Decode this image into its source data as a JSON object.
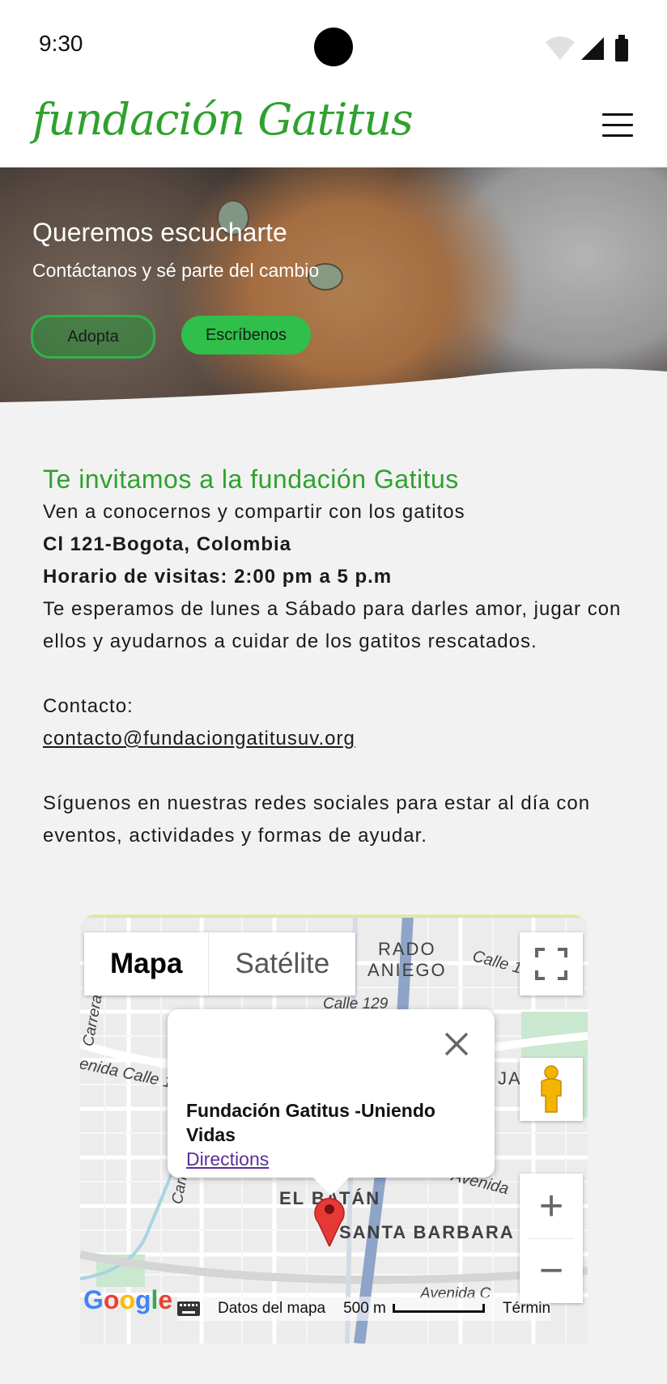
{
  "status_bar": {
    "time": "9:30"
  },
  "header": {
    "logo": "fundación Gatitus",
    "menu_icon": "hamburger-menu-icon"
  },
  "hero": {
    "title": "Queremos escucharte",
    "subtitle": "Contáctanos y sé parte del cambio",
    "buttons": {
      "adopt": "Adopta",
      "write": "Escríbenos"
    }
  },
  "content": {
    "heading": "Te invitamos a la fundación Gatitus",
    "line1": "Ven a conocernos y compartir con los gatitos",
    "address": "Cl 121-Bogota, Colombia",
    "hours": "Horario de visitas: 2:00 pm a 5 p.m",
    "description": "Te esperamos de lunes a Sábado para darles amor, jugar con ellos y ayudarnos a cuidar de los gatitos rescatados.",
    "contact_label": "Contacto:",
    "contact_email": "contacto@fundaciongatitusuv.org",
    "social_text": "Síguenos en nuestras redes sociales para estar al día con eventos, actividades y formas de ayudar."
  },
  "map": {
    "type_options": {
      "map": "Mapa",
      "satellite": "Satélite"
    },
    "info_window": {
      "place_name": "Fundación Gatitus -Uniendo Vidas",
      "directions": "Directions"
    },
    "zoom": {
      "in": "+",
      "out": "−"
    },
    "labels": {
      "rado": "RADO",
      "aniego": "ANIEGO",
      "calle_top": "Calle 1",
      "calle_129": "Calle 129",
      "carrera_left": "Carrera",
      "avenida_calle": "enida Calle 1",
      "ja": "JA",
      "avenida_right": "Avenida",
      "carrera_mid": "Carrera",
      "el_batan": "EL BATÁN",
      "santa_barbara": "SANTA BARBARA",
      "avenida_bottom": "Avenida C"
    },
    "footer": {
      "google": "Google",
      "map_data": "Datos del mapa",
      "scale": "500 m",
      "terms": "Términ"
    },
    "colors": {
      "pin": "#e53935",
      "highway": "#8ea4c8",
      "park": "#c9e8cf"
    }
  }
}
